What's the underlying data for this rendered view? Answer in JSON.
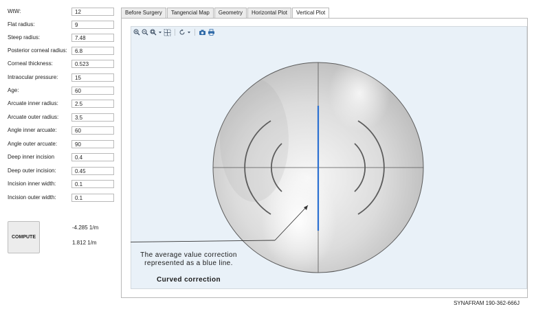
{
  "params": [
    {
      "label": "WtW:",
      "value": "12"
    },
    {
      "label": "Flat radius:",
      "value": "9"
    },
    {
      "label": "Steep radius:",
      "value": "7.48"
    },
    {
      "label": "Posterior corneal radius:",
      "value": "6.8"
    },
    {
      "label": "Corneal thickness:",
      "value": "0.523"
    },
    {
      "label": "Intraocular pressure:",
      "value": "15"
    },
    {
      "label": "Age:",
      "value": "60"
    },
    {
      "label": "Arcuate inner radius:",
      "value": "2.5"
    },
    {
      "label": "Arcuate outer radius:",
      "value": "3.5"
    },
    {
      "label": "Angle inner arcuate:",
      "value": "60"
    },
    {
      "label": "Angle outer arcuate:",
      "value": "90"
    },
    {
      "label": "Deep inner incision",
      "value": "0.4"
    },
    {
      "label": "Deep outer incision:",
      "value": "0.45"
    },
    {
      "label": "Incision inner width:",
      "value": "0.1"
    },
    {
      "label": "Incision outer width:",
      "value": "0.1"
    }
  ],
  "compute": {
    "label": "COMPUTE"
  },
  "results": {
    "first": "-4.285 1/m",
    "second": "1.812 1/m"
  },
  "tabs": [
    {
      "label": "Before Surgery",
      "active": false
    },
    {
      "label": "Tangencial Map",
      "active": false
    },
    {
      "label": "Geometry",
      "active": false
    },
    {
      "label": "Horizontal Plot",
      "active": false
    },
    {
      "label": "Vertical Plot",
      "active": true
    }
  ],
  "toolbar": {
    "icons": [
      "zoom-in-icon",
      "zoom-out-icon",
      "zoom-box-icon",
      "dropdown-icon",
      "zoom-extents-icon",
      "rotate-icon",
      "dropdown-icon",
      "camera-icon",
      "print-icon"
    ]
  },
  "annotation": {
    "line1": "The average value correction",
    "line2": "represented as a blue line.",
    "title": "Curved correction"
  },
  "colors": {
    "correction_line": "#2a6fd1",
    "plot_background": "#e9f1f8",
    "tab_active": "#ffffff",
    "tab_inactive": "#ececec"
  },
  "footer": "SYNAFRAM 190-362-666J"
}
